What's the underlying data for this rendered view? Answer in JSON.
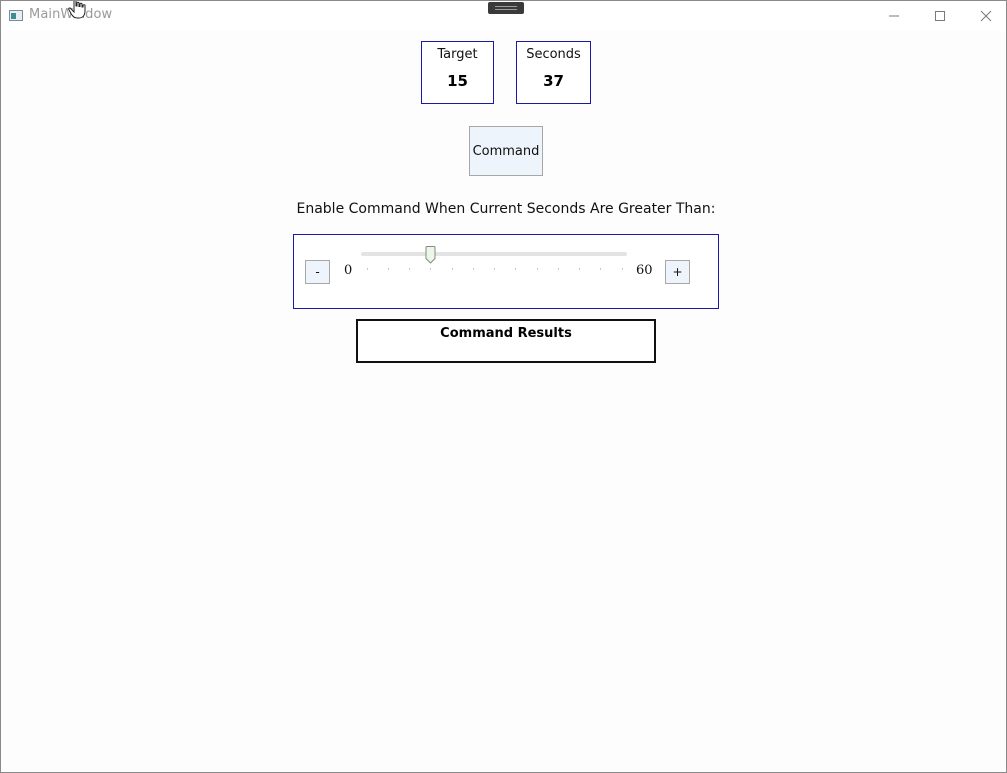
{
  "window": {
    "title": "MainWindow",
    "icon": "app-window-icon",
    "controls": [
      "minimize-icon",
      "maximize-icon",
      "close-icon"
    ]
  },
  "cards": {
    "target": {
      "label": "Target",
      "value": "15"
    },
    "seconds": {
      "label": "Seconds",
      "value": "37"
    }
  },
  "command": {
    "label": "Command"
  },
  "enable": {
    "label": "Enable Command When Current Seconds Are Greater Than:"
  },
  "slider": {
    "decrement_label": "-",
    "increment_label": "+",
    "min_label": "0",
    "max_label": "60",
    "min": 0,
    "max": 60,
    "value": 15,
    "tick_frequency": 5
  },
  "results": {
    "title": "Command Results"
  },
  "colors": {
    "panel_border": "#1a1aa6",
    "button_bg": "#eef4fb",
    "button_border": "#a7a7a7"
  }
}
